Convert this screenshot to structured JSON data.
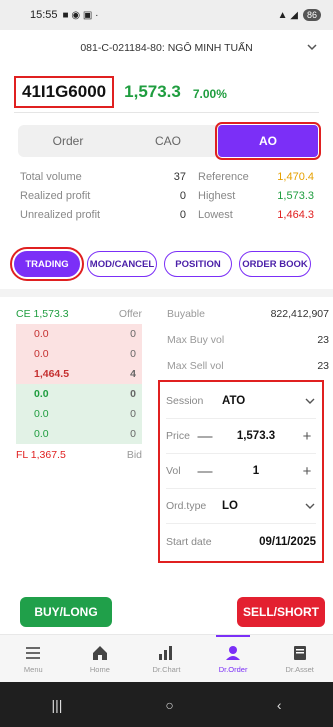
{
  "statusbar": {
    "time": "15:55",
    "battery": "86"
  },
  "account": {
    "label": "081-C-021184-80: NGÔ MINH TUẤN"
  },
  "symbol": {
    "code": "41I1G6000",
    "price": "1,573.3",
    "change_pct": "7.00%"
  },
  "order_tabs": [
    {
      "label": "Order"
    },
    {
      "label": "CAO"
    },
    {
      "label": "AO"
    }
  ],
  "stats": {
    "total_volume_label": "Total volume",
    "total_volume": "37",
    "realized_profit_label": "Realized profit",
    "realized_profit": "0",
    "unrealized_profit_label": "Unrealized profit",
    "unrealized_profit": "0",
    "reference_label": "Reference",
    "reference": "1,470.4",
    "highest_label": "Highest",
    "highest": "1,573.3",
    "lowest_label": "Lowest",
    "lowest": "1,464.3"
  },
  "sub_tabs": [
    {
      "label": "TRADING"
    },
    {
      "label": "MOD/CANCEL"
    },
    {
      "label": "POSITION"
    },
    {
      "label": "ORDER BOOK"
    }
  ],
  "book": {
    "ce": "CE 1,573.3",
    "offer_label": "Offer",
    "asks": [
      {
        "price": "0.0",
        "qty": "0"
      },
      {
        "price": "0.0",
        "qty": "0"
      },
      {
        "price": "1,464.5",
        "qty": "4"
      }
    ],
    "bids": [
      {
        "price": "0.0",
        "qty": "0"
      },
      {
        "price": "0.0",
        "qty": "0"
      },
      {
        "price": "0.0",
        "qty": "0"
      }
    ],
    "fl": "FL 1,367.5",
    "bid_label": "Bid"
  },
  "info": {
    "buyable_label": "Buyable",
    "buyable": "822,412,907",
    "max_buy_label": "Max Buy vol",
    "max_buy": "23",
    "max_sell_label": "Max Sell vol",
    "max_sell": "23"
  },
  "form": {
    "session_label": "Session",
    "session": "ATO",
    "price_label": "Price",
    "price": "1,573.3",
    "vol_label": "Vol",
    "vol": "1",
    "ordtype_label": "Ord.type",
    "ordtype": "LO",
    "startdate_label": "Start date",
    "startdate": "09/11/2025"
  },
  "buttons": {
    "buy": "BUY/LONG",
    "sell": "SELL/SHORT"
  },
  "tabbar": [
    {
      "label": "Menu",
      "icon": "menu-icon"
    },
    {
      "label": "Home",
      "icon": "home-icon"
    },
    {
      "label": "Dr.Chart",
      "icon": "chart-icon"
    },
    {
      "label": "Dr.Order",
      "icon": "order-icon"
    },
    {
      "label": "Dr.Asset",
      "icon": "asset-icon"
    }
  ],
  "colors": {
    "accent": "#7b2ff7",
    "up": "#1f9d3f",
    "down": "#e02020",
    "highlight": "#e02020"
  }
}
